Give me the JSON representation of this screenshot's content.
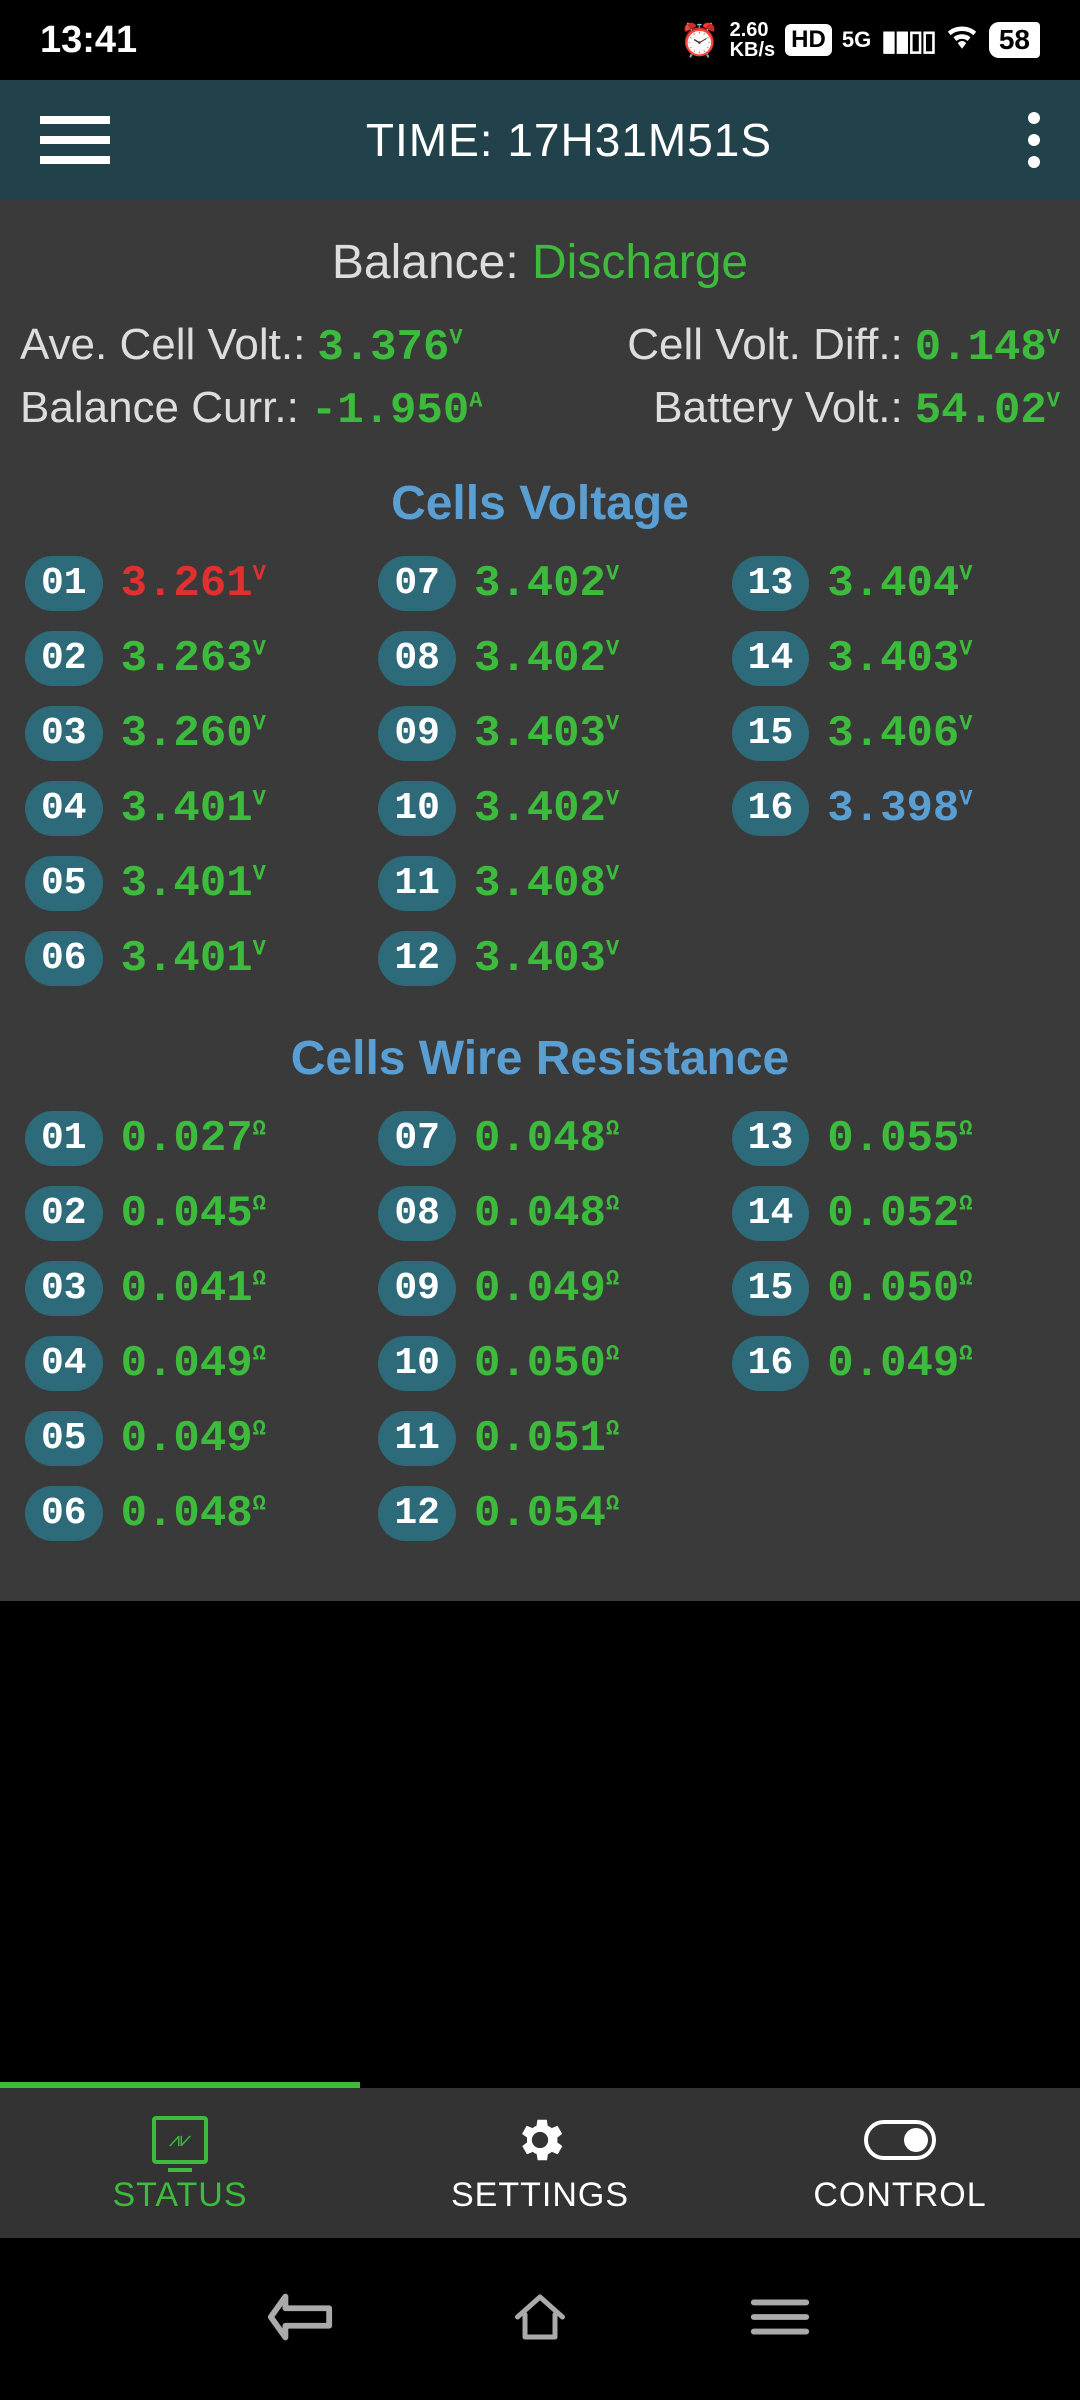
{
  "status_bar": {
    "time": "13:41",
    "speed_value": "2.60",
    "speed_unit": "KB/s",
    "hd": "HD",
    "network": "5G",
    "battery": "58"
  },
  "header": {
    "title": "TIME: 17H31M51S"
  },
  "balance": {
    "label": "Balance: ",
    "value": "Discharge"
  },
  "stats": {
    "avg_cell_label": "Ave. Cell Volt.:",
    "avg_cell_value": "3.376",
    "avg_cell_unit": "V",
    "cell_diff_label": "Cell Volt. Diff.:",
    "cell_diff_value": "0.148",
    "cell_diff_unit": "V",
    "balance_curr_label": "Balance Curr.:",
    "balance_curr_value": "-1.950",
    "balance_curr_unit": "A",
    "battery_volt_label": "Battery Volt.:",
    "battery_volt_value": "54.02",
    "battery_volt_unit": "V"
  },
  "sections": {
    "voltage_title": "Cells Voltage",
    "resistance_title": "Cells Wire Resistance"
  },
  "voltage_cells": {
    "c01_n": "01",
    "c01_v": "3.261",
    "c02_n": "02",
    "c02_v": "3.263",
    "c03_n": "03",
    "c03_v": "3.260",
    "c04_n": "04",
    "c04_v": "3.401",
    "c05_n": "05",
    "c05_v": "3.401",
    "c06_n": "06",
    "c06_v": "3.401",
    "c07_n": "07",
    "c07_v": "3.402",
    "c08_n": "08",
    "c08_v": "3.402",
    "c09_n": "09",
    "c09_v": "3.403",
    "c10_n": "10",
    "c10_v": "3.402",
    "c11_n": "11",
    "c11_v": "3.408",
    "c12_n": "12",
    "c12_v": "3.403",
    "c13_n": "13",
    "c13_v": "3.404",
    "c14_n": "14",
    "c14_v": "3.403",
    "c15_n": "15",
    "c15_v": "3.406",
    "c16_n": "16",
    "c16_v": "3.398",
    "unit": "V"
  },
  "resistance_cells": {
    "c01_n": "01",
    "c01_v": "0.027",
    "c02_n": "02",
    "c02_v": "0.045",
    "c03_n": "03",
    "c03_v": "0.041",
    "c04_n": "04",
    "c04_v": "0.049",
    "c05_n": "05",
    "c05_v": "0.049",
    "c06_n": "06",
    "c06_v": "0.048",
    "c07_n": "07",
    "c07_v": "0.048",
    "c08_n": "08",
    "c08_v": "0.048",
    "c09_n": "09",
    "c09_v": "0.049",
    "c10_n": "10",
    "c10_v": "0.050",
    "c11_n": "11",
    "c11_v": "0.051",
    "c12_n": "12",
    "c12_v": "0.054",
    "c13_n": "13",
    "c13_v": "0.055",
    "c14_n": "14",
    "c14_v": "0.052",
    "c15_n": "15",
    "c15_v": "0.050",
    "c16_n": "16",
    "c16_v": "0.049",
    "unit": "Ω"
  },
  "nav": {
    "status": "STATUS",
    "settings": "SETTINGS",
    "control": "CONTROL"
  }
}
